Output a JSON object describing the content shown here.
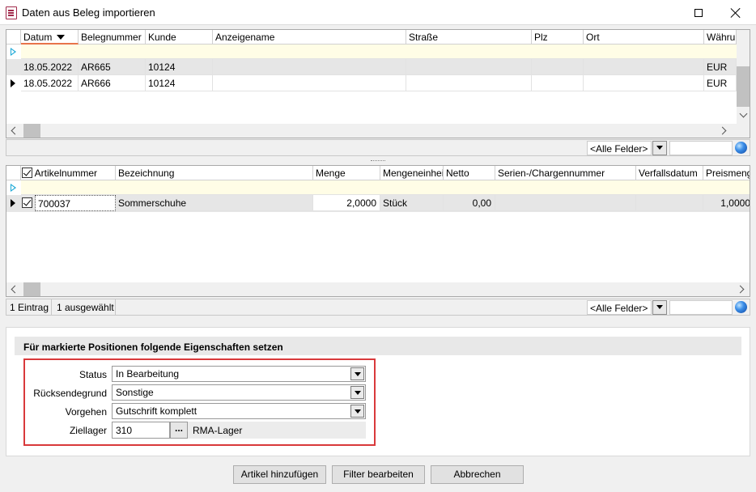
{
  "window": {
    "title": "Daten aus Beleg importieren"
  },
  "top_grid": {
    "columns": [
      "Datum",
      "Belegnummer",
      "Kunde",
      "Anzeigename",
      "Straße",
      "Plz",
      "Ort",
      "Währu"
    ],
    "rows": [
      [
        "18.05.2022",
        "AR665",
        "10124",
        "",
        "",
        "",
        "",
        "EUR"
      ],
      [
        "18.05.2022",
        "AR666",
        "10124",
        "",
        "",
        "",
        "",
        "EUR"
      ]
    ],
    "field_filter": "<Alle Felder>"
  },
  "bottom_grid": {
    "columns": [
      "Artikelnummer",
      "Bezeichnung",
      "Menge",
      "Mengeneinheit",
      "Netto",
      "Serien-/Chargennummer",
      "Verfallsdatum",
      "Preismenge"
    ],
    "rows": [
      [
        "700037",
        "Sommerschuhe",
        "2,0000",
        "Stück",
        "0,00",
        "",
        "",
        "1,0000"
      ]
    ],
    "status_count": "1 Eintrag",
    "status_selected": "1 ausgewählt",
    "field_filter": "<Alle Felder>"
  },
  "properties": {
    "header": "Für markierte Positionen folgende Eigenschaften setzen",
    "status_label": "Status",
    "status_value": "In Bearbeitung",
    "reason_label": "Rücksendegrund",
    "reason_value": "Sonstige",
    "action_label": "Vorgehen",
    "action_value": "Gutschrift komplett",
    "warehouse_label": "Ziellager",
    "warehouse_value": "310",
    "warehouse_browse": "...",
    "warehouse_name": "RMA-Lager"
  },
  "buttons": {
    "add": "Artikel hinzufügen",
    "filter": "Filter bearbeiten",
    "cancel": "Abbrechen"
  },
  "colors": {
    "accent_red": "#d9393b",
    "filter_row": "#fffde6",
    "selection_row": "#e6e6e6"
  }
}
